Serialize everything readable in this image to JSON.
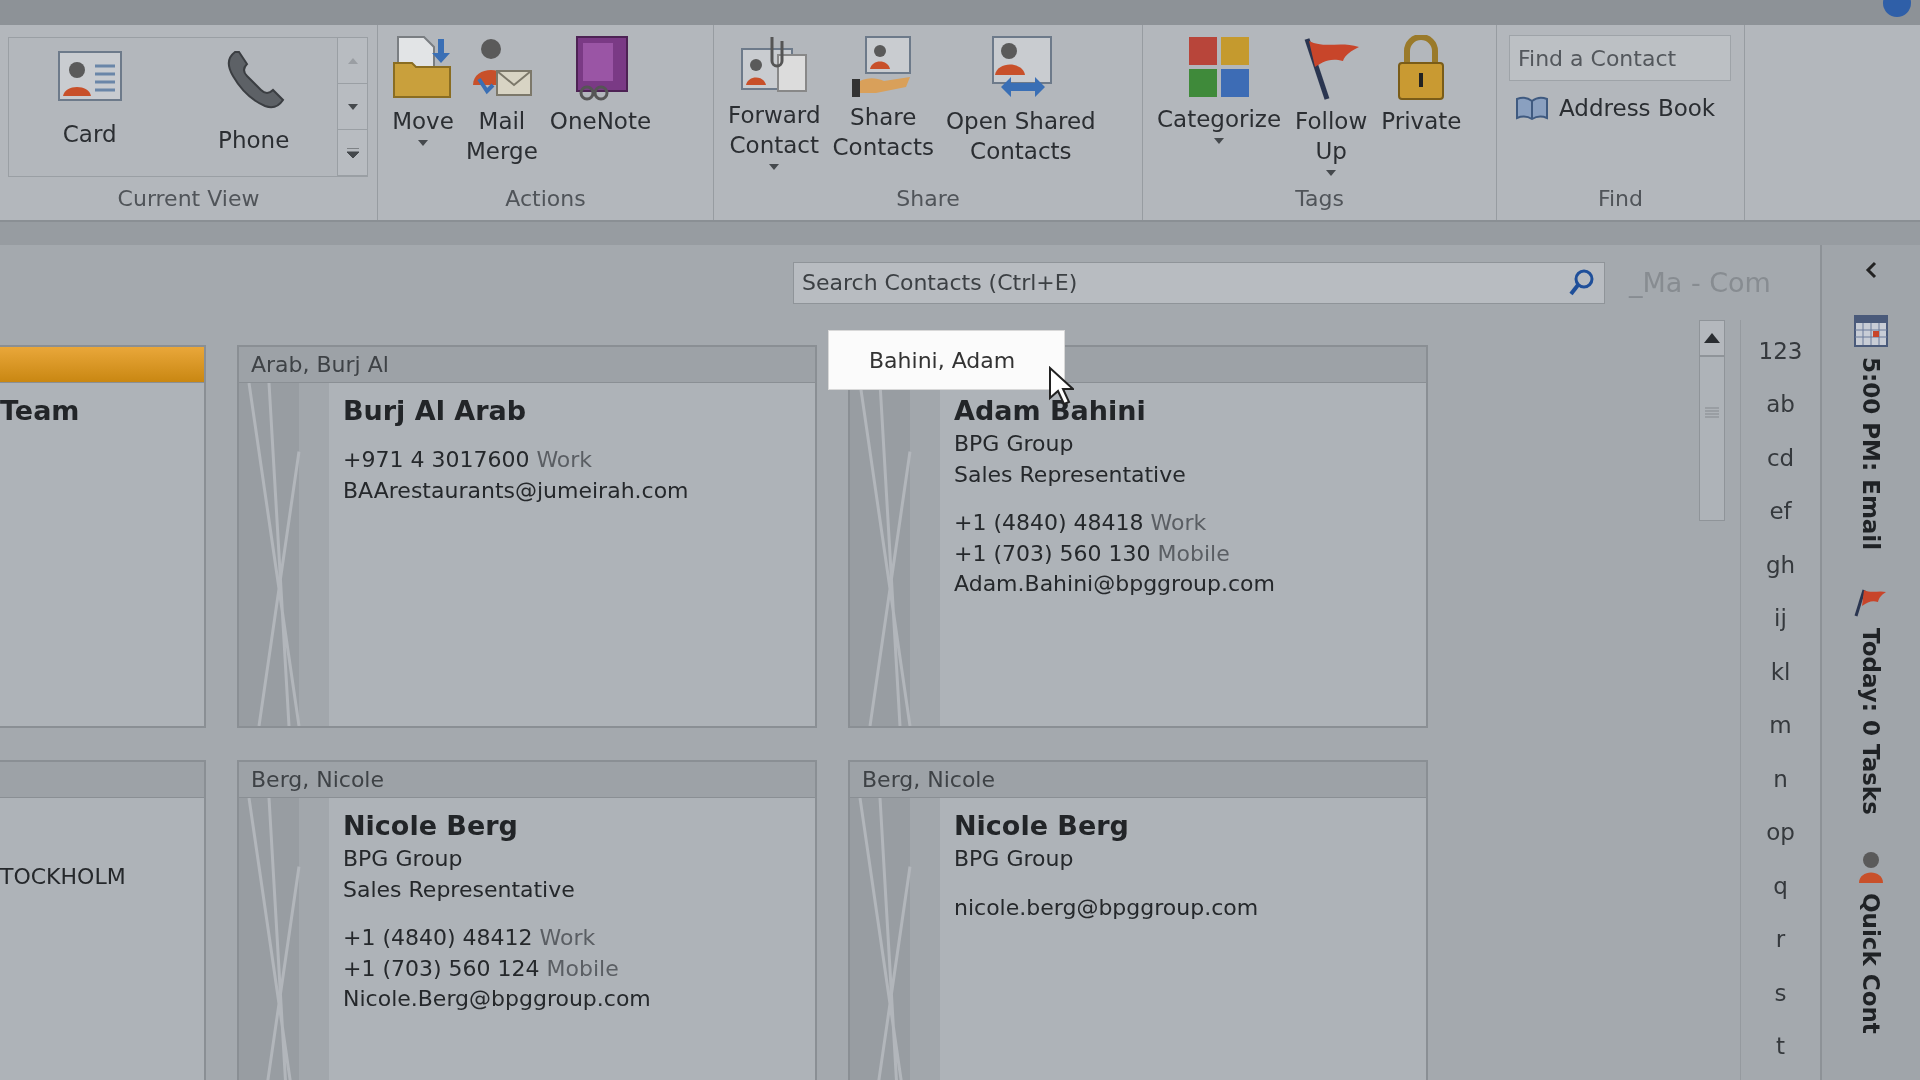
{
  "ribbon": {
    "groups": [
      {
        "label": "Current View",
        "buttons": [
          {
            "label": "Card"
          },
          {
            "label": "Phone"
          }
        ]
      },
      {
        "label": "Actions",
        "buttons": [
          {
            "label": "Move",
            "dropdown": true
          },
          {
            "label": "Mail\nMerge",
            "dropdown": false
          },
          {
            "label": "OneNote",
            "dropdown": false
          }
        ]
      },
      {
        "label": "Share",
        "buttons": [
          {
            "label": "Forward\nContact",
            "dropdown": true
          },
          {
            "label": "Share\nContacts",
            "dropdown": false
          },
          {
            "label": "Open Shared\nContacts",
            "dropdown": false
          }
        ]
      },
      {
        "label": "Tags",
        "buttons": [
          {
            "label": "Categorize",
            "dropdown": true
          },
          {
            "label": "Follow\nUp",
            "dropdown": true
          },
          {
            "label": "Private",
            "dropdown": false
          }
        ]
      }
    ],
    "find": {
      "label": "Find",
      "search": {
        "placeholder": "Find a Contact"
      },
      "address_book": "Address Book"
    }
  },
  "search": {
    "placeholder": "Search Contacts (Ctrl+E)"
  },
  "folder_title": "_Ma - Com",
  "cards": [
    {
      "selected": true,
      "name": "Team"
    },
    {
      "header": "Arab, Burj Al",
      "selected": false,
      "name": "Burj Al Arab",
      "lines": [
        {
          "kind": "phone",
          "number": "+971 4 3017600",
          "label": "Work"
        },
        {
          "kind": "text",
          "text": "BAArestaurants@jumeirah.com"
        }
      ]
    },
    {
      "header": "Bahini, Adam",
      "selected": false,
      "hovered": true,
      "name": "Adam Bahini",
      "lines": [
        {
          "kind": "text",
          "text": "BPG Group"
        },
        {
          "kind": "text",
          "text": "Sales Representative"
        },
        {
          "kind": "gap"
        },
        {
          "kind": "phone",
          "number": "+1 (4840) 48418",
          "label": "Work"
        },
        {
          "kind": "phone",
          "number": "+1 (703) 560 130",
          "label": "Mobile"
        },
        {
          "kind": "text",
          "text": "Adam.Bahini@bpggroup.com"
        }
      ]
    },
    {
      "selected": false,
      "lines": [
        {
          "kind": "gap"
        },
        {
          "kind": "gap"
        },
        {
          "kind": "gap"
        },
        {
          "kind": "text",
          "text": "TOCKHOLM"
        }
      ]
    },
    {
      "header": "Berg, Nicole",
      "selected": false,
      "name": "Nicole Berg",
      "lines": [
        {
          "kind": "text",
          "text": "BPG Group"
        },
        {
          "kind": "text",
          "text": "Sales Representative"
        },
        {
          "kind": "gap"
        },
        {
          "kind": "phone",
          "number": "+1 (4840) 48412",
          "label": "Work"
        },
        {
          "kind": "phone",
          "number": "+1 (703) 560 124",
          "label": "Mobile"
        },
        {
          "kind": "text",
          "text": "Nicole.Berg@bpggroup.com"
        }
      ]
    },
    {
      "header": "Berg, Nicole",
      "selected": false,
      "name": "Nicole Berg",
      "lines": [
        {
          "kind": "text",
          "text": "BPG Group"
        },
        {
          "kind": "gap"
        },
        {
          "kind": "text",
          "text": "nicole.berg@bpggroup.com"
        }
      ]
    }
  ],
  "index": [
    "123",
    "ab",
    "cd",
    "ef",
    "gh",
    "ij",
    "kl",
    "m",
    "n",
    "op",
    "q",
    "r",
    "s",
    "t"
  ],
  "todo_bar": [
    {
      "kind": "appointment",
      "text": "5:00 PM: Email"
    },
    {
      "kind": "tasks",
      "text": "Today: 0 Tasks"
    },
    {
      "kind": "contacts",
      "text": "Quick Cont"
    }
  ]
}
